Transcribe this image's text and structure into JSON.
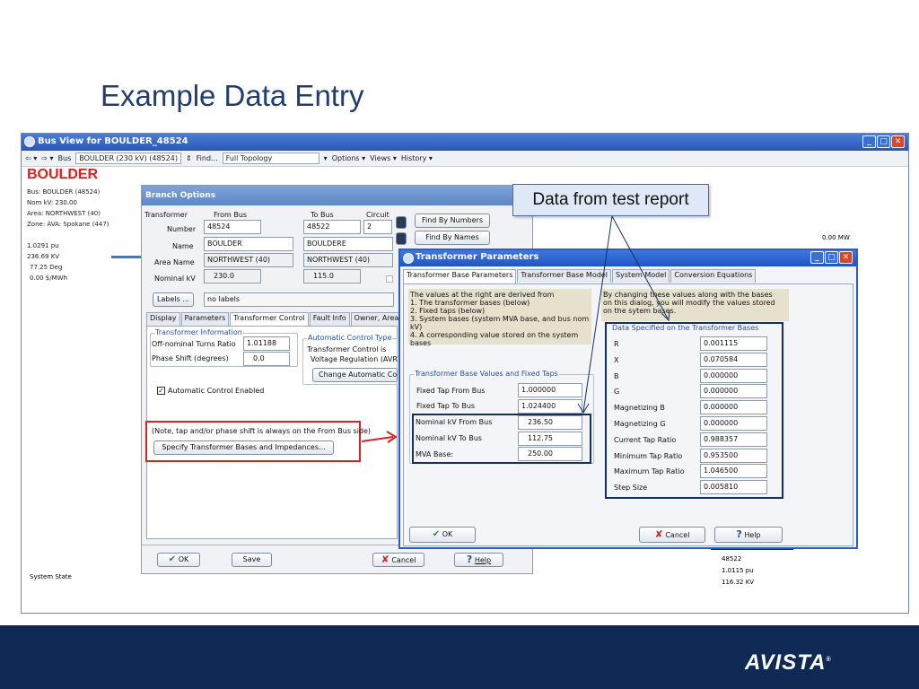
{
  "slide": {
    "title": "Example Data Entry"
  },
  "app": {
    "window_title": "Bus View  for BOULDER_48524",
    "toolbar": {
      "bus_label": "Bus",
      "bus_value": "BOULDER (230 kV) (48524)",
      "find_label": "Find...",
      "topology_value": "Full Topology",
      "options_label": "Options",
      "views_label": "Views",
      "history_label": "History"
    },
    "left_panel": {
      "bus_name": "BOULDER",
      "bus": "Bus: BOULDER (48524)",
      "nom_kv": "Nom kV: 230.00",
      "area": "Area: NORTHWEST (40)",
      "zone": "Zone: AVA: Spokane (447)",
      "pu": "1.0291 pu",
      "kv": "236.69 KV",
      "deg": "77.25 Deg",
      "price": "0.00 $/MWh",
      "system_state": "System State"
    },
    "right_info": {
      "mw": "0.00 MW",
      "bus_num": "48522",
      "pu": "1.0115 pu",
      "kv": "116.32 KV"
    }
  },
  "branch": {
    "title": "Branch Options",
    "transformer_label": "Transformer",
    "from_bus_label": "From Bus",
    "to_bus_label": "To Bus",
    "circuit_label": "Circuit",
    "number_label": "Number",
    "from_number": "48524",
    "to_number": "48522",
    "circuit": "2",
    "name_label": "Name",
    "from_name": "BOULDER",
    "to_name": "BOULDERE",
    "area_label": "Area Name",
    "from_area": "NORTHWEST (40)",
    "to_area": "NORTHWEST (40)",
    "nomkv_label": "Nominal kV",
    "from_kv": "230.0",
    "to_kv": "115.0",
    "find_numbers": "Find By Numbers",
    "find_names": "Find By Names",
    "labels_button": "Labels ...",
    "labels_value": "no labels",
    "tabs": [
      "Display",
      "Parameters",
      "Transformer Control",
      "Fault Info",
      "Owner, Area, Zo"
    ],
    "xf_info_label": "Transformer Information",
    "off_nominal_label": "Off-nominal Turns Ratio",
    "off_nominal_value": "1.01188",
    "phase_shift_label": "Phase Shift (degrees)",
    "phase_shift_value": "0.0",
    "auto_type_label": "Automatic Control Type",
    "auto_type_line1": "Transformer Control is",
    "auto_type_line2": "Voltage Regulation (AVR)",
    "change_auto": "Change Automatic Contr",
    "auto_enabled": "Automatic Control Enabled",
    "note": "(Note, tap and/or phase shift is always on the From Bus side)",
    "specify_button": "Specify Transformer Bases and Impedances...",
    "ok": "OK",
    "save": "Save",
    "cancel": "Cancel",
    "help": "Help"
  },
  "callout": {
    "text": "Data from test report"
  },
  "tp": {
    "title": "Transformer Parameters",
    "tabs": [
      "Transformer Base Parameters",
      "Transformer Base Model",
      "System Model",
      "Conversion Equations"
    ],
    "left_note": [
      "The values at the right are derived from",
      "1. The transformer bases (below)",
      "2. Fixed taps (below)",
      "3. System bases (system MVA base, and bus nom kV)",
      "4. A corresponding value stored on the system bases"
    ],
    "right_note": [
      "By changing these values along with the bases",
      "on this dialog, you will modify the values stored",
      "on the sytem bases."
    ],
    "bases_group_label": "Transformer Base Values and Fixed Taps",
    "fixed_from_label": "Fixed Tap From Bus",
    "fixed_from": "1.000000",
    "fixed_to_label": "Fixed Tap To Bus",
    "fixed_to": "1.024400",
    "nomkv_from_label": "Nominal kV From Bus",
    "nomkv_from": "236.50",
    "nomkv_to_label": "Nominal kV To Bus",
    "nomkv_to": "112.75",
    "mva_label": "MVA Base:",
    "mva": "250.00",
    "spec_group_label": "Data Specified on the Transformer Bases",
    "params": [
      {
        "label": "R",
        "value": "0.001115"
      },
      {
        "label": "X",
        "value": "0.070584"
      },
      {
        "label": "B",
        "value": "0.000000"
      },
      {
        "label": "G",
        "value": "0.000000"
      },
      {
        "label": "Magnetizing B",
        "value": "0.000000"
      },
      {
        "label": "Magnetizing G",
        "value": "0.000000"
      },
      {
        "label": "Current Tap Ratio",
        "value": "0.988357"
      },
      {
        "label": "Minimum Tap Ratio",
        "value": "0.953500"
      },
      {
        "label": "Maximum Tap Ratio",
        "value": "1.046500"
      },
      {
        "label": "Step Size",
        "value": "0.005810"
      }
    ],
    "ok": "OK",
    "cancel": "Cancel",
    "help": "Help"
  },
  "footer": {
    "logo": "AVISTA"
  },
  "colors": {
    "title_blue": "#1f3d6e",
    "footer_navy": "#0e2a55",
    "highlight_red": "#d42424",
    "highlight_dark": "#12305e"
  }
}
